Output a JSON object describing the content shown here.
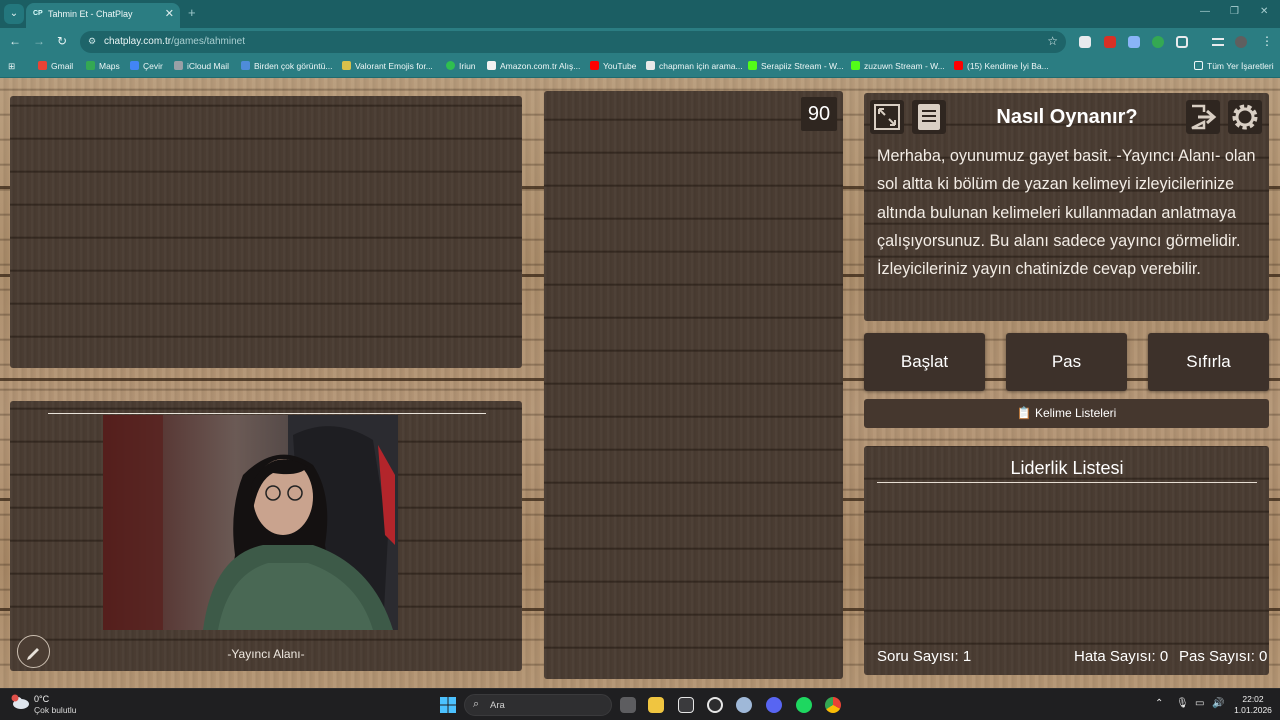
{
  "browser": {
    "tab_title": "Tahmin Et - ChatPlay",
    "tab_favicon": "CP",
    "url_host": "chatplay.com.tr",
    "url_path": "/games/tahminet"
  },
  "bookmarks": [
    {
      "label": "Gmail",
      "color": "#ea4335"
    },
    {
      "label": "Maps",
      "color": "#34a853"
    },
    {
      "label": "Çevir",
      "color": "#4285f4"
    },
    {
      "label": "iCloud Mail",
      "color": "#9aa0a6"
    },
    {
      "label": "Birden çok görüntü...",
      "color": "#4e8cd9"
    },
    {
      "label": "Valorant Emojis for...",
      "color": "#d8c04a"
    },
    {
      "label": "Iriun",
      "color": "#2fbf4f"
    },
    {
      "label": "Amazon.com.tr Alış...",
      "color": "#f2f2f2"
    },
    {
      "label": "YouTube",
      "color": "#ff0000"
    },
    {
      "label": "chapman için arama...",
      "color": "#e8e8e8"
    },
    {
      "label": "Serapiiz Stream - W...",
      "color": "#53fc18"
    },
    {
      "label": "zuzuwn Stream - W...",
      "color": "#53fc18"
    },
    {
      "label": "(15) Kendime İyi Ba...",
      "color": "#ff0000"
    }
  ],
  "bookmarks_all": "Tüm Yer İşaretleri",
  "game": {
    "timer": "90",
    "how_to_title": "Nasıl Oynanır?",
    "how_to_text": "Merhaba, oyunumuz gayet basit. -Yayıncı Alanı- olan sol altta ki bölüm de yazan kelimeyi izleyicilerinize altında bulunan kelimeleri kullanmadan anlatmaya çalışıyorsunuz. Bu alanı sadece yayıncı görmelidir. İzleyicileriniz yayın chatinizde cevap verebilir.",
    "buttons": {
      "start": "Başlat",
      "pass": "Pas",
      "reset": "Sıfırla",
      "word_lists": "📋 Kelime Listeleri"
    },
    "leaderboard_title": "Liderlik Listesi",
    "stats": {
      "questions": "Soru Sayısı: 1",
      "errors": "Hata Sayısı: 0",
      "passes": "Pas Sayısı: 0"
    },
    "streamer_area_label": "-Yayıncı Alanı-"
  },
  "taskbar": {
    "temperature": "0°C",
    "weather": "Çok bulutlu",
    "search_placeholder": "Ara",
    "time": "22:02",
    "date": "1.01.2026"
  }
}
